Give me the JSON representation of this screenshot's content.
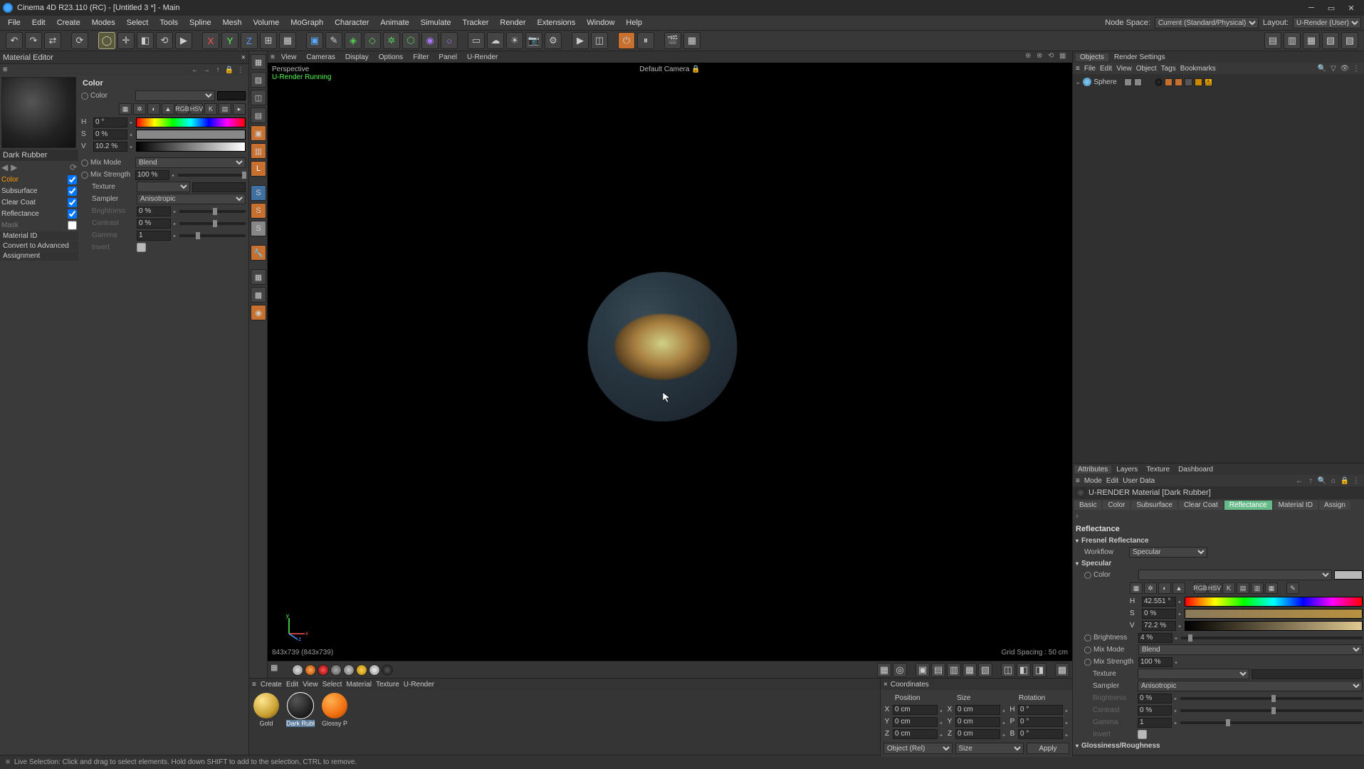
{
  "window": {
    "title": "Cinema 4D R23.110 (RC) - [Untitled 3 *] - Main"
  },
  "menubar": {
    "items": [
      "File",
      "Edit",
      "Create",
      "Modes",
      "Select",
      "Tools",
      "Spline",
      "Mesh",
      "Volume",
      "MoGraph",
      "Character",
      "Animate",
      "Simulate",
      "Tracker",
      "Render",
      "Extensions",
      "Window",
      "Help"
    ],
    "node_space_label": "Node Space:",
    "node_space_value": "Current (Standard/Physical)",
    "layout_label": "Layout:",
    "layout_value": "U-Render (User)"
  },
  "material_editor": {
    "title": "Material Editor",
    "material_name": "Dark Rubber",
    "channels": [
      {
        "label": "Color",
        "checked": true,
        "enabled": true
      },
      {
        "label": "Subsurface",
        "checked": true,
        "enabled": false
      },
      {
        "label": "Clear Coat",
        "checked": true,
        "enabled": false
      },
      {
        "label": "Reflectance",
        "checked": true,
        "enabled": false
      },
      {
        "label": "Mask",
        "checked": false,
        "enabled": false
      }
    ],
    "material_id": "Material ID",
    "convert": "Convert to Advanced",
    "assignment": "Assignment",
    "section": "Color",
    "color_lbl": "Color",
    "hsv": {
      "H_lbl": "H",
      "S_lbl": "S",
      "V_lbl": "V",
      "H": "0 °",
      "S": "0 %",
      "V": "10.2 %"
    },
    "icon_row_labels": [
      "",
      "",
      "",
      "",
      "RGB",
      "HSV",
      "K",
      "",
      ""
    ],
    "mix_mode_lbl": "Mix Mode",
    "mix_mode": "Blend",
    "mix_strength_lbl": "Mix Strength",
    "mix_strength": "100 %",
    "texture_lbl": "Texture",
    "sampler_lbl": "Sampler",
    "sampler": "Anisotropic",
    "brightness_lbl": "Brightness",
    "brightness": "0 %",
    "contrast_lbl": "Contrast",
    "contrast": "0 %",
    "gamma_lbl": "Gamma",
    "gamma": "1",
    "invert_lbl": "Invert"
  },
  "viewport_menu": [
    "View",
    "Cameras",
    "Display",
    "Options",
    "Filter",
    "Panel",
    "U-Render"
  ],
  "viewport": {
    "view_name": "Perspective",
    "render_status": "U-Render Running",
    "camera": "Default Camera",
    "dim": "843x739 (843x739)",
    "grid": "Grid Spacing : 50 cm"
  },
  "material_browser": {
    "menu": [
      "Create",
      "Edit",
      "View",
      "Select",
      "Material",
      "Texture",
      "U-Render"
    ],
    "materials": [
      {
        "name": "Gold",
        "color": "radial-gradient(circle at 35% 30%,#ffe690,#caa030 60%,#6a4a10)"
      },
      {
        "name": "Dark Rubber",
        "color": "radial-gradient(circle at 35% 30%,#555,#222 60%,#0a0a0a)",
        "selected": true
      },
      {
        "name": "Glossy P",
        "color": "radial-gradient(circle at 35% 30%,#ffb050,#f07010 60%,#a04000)"
      }
    ]
  },
  "coordinates": {
    "title": "Coordinates",
    "headers": [
      "Position",
      "Size",
      "Rotation"
    ],
    "rows": [
      {
        "axis": "X",
        "pos": "0 cm",
        "size_axis": "X",
        "size": "0 cm",
        "rot_axis": "H",
        "rot": "0 °"
      },
      {
        "axis": "Y",
        "pos": "0 cm",
        "size_axis": "Y",
        "size": "0 cm",
        "rot_axis": "P",
        "rot": "0 °"
      },
      {
        "axis": "Z",
        "pos": "0 cm",
        "size_axis": "Z",
        "size": "0 cm",
        "rot_axis": "B",
        "rot": "0 °"
      }
    ],
    "mode": "Object (Rel)",
    "size_mode": "Size",
    "apply": "Apply"
  },
  "objects": {
    "tabs": [
      "Objects",
      "Render Settings"
    ],
    "menu": [
      "File",
      "Edit",
      "View",
      "Object",
      "Tags",
      "Bookmarks"
    ],
    "tree": [
      {
        "name": "Sphere"
      }
    ]
  },
  "attributes": {
    "tabs": [
      "Attributes",
      "Layers",
      "Texture",
      "Dashboard"
    ],
    "menu": [
      "Mode",
      "Edit",
      "User Data"
    ],
    "material_header": "U-RENDER Material [Dark Rubber]",
    "mat_tabs": [
      "Basic",
      "Color",
      "Subsurface",
      "Clear Coat",
      "Reflectance",
      "Material ID",
      "Assign"
    ],
    "mat_tab_active": "Reflectance",
    "section_reflectance": "Reflectance",
    "section_fresnel": "Fresnel Reflectance",
    "workflow_lbl": "Workflow",
    "workflow": "Specular",
    "section_specular": "Specular",
    "color_lbl": "Color",
    "hsv": {
      "H_lbl": "H",
      "S_lbl": "S",
      "V_lbl": "V",
      "H": "42.551 °",
      "S": "0 %",
      "V": "72.2 %"
    },
    "brightness_lbl": "Brightness",
    "brightness": "4 %",
    "mix_mode_lbl": "Mix Mode",
    "mix_mode": "Blend",
    "mix_strength_lbl": "Mix Strength",
    "mix_strength": "100 %",
    "texture_lbl": "Texture",
    "sampler_lbl": "Sampler",
    "sampler": "Anisotropic",
    "brightness2_lbl": "Brightness",
    "brightness2": "0 %",
    "contrast_lbl": "Contrast",
    "contrast": "0 %",
    "gamma_lbl": "Gamma",
    "gamma": "1",
    "invert_lbl": "Invert",
    "section_gloss": "Glossiness/Roughness"
  },
  "status": "Live Selection: Click and drag to select elements. Hold down SHIFT to add to the selection, CTRL to remove."
}
